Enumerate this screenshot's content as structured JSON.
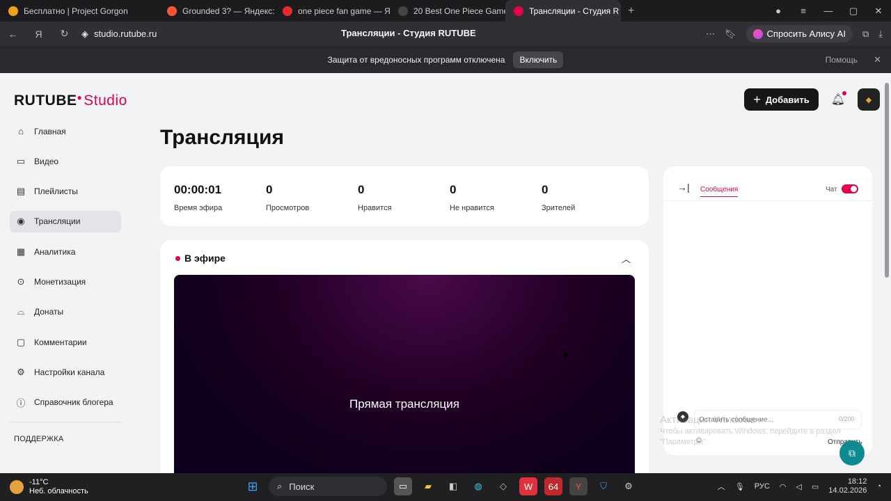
{
  "browser": {
    "tabs": [
      {
        "label": "Бесплатно | Project Gorgon",
        "color": "#f0a020"
      },
      {
        "label": "Grounded 3? — Яндекс: на",
        "color": "#ff5533"
      },
      {
        "label": "one piece fan game — Янд",
        "color": "#e22d2d"
      },
      {
        "label": "20 Best One Piece Games",
        "color": "#444444"
      },
      {
        "label": "Трансляции - Студия R",
        "color": "#e6004c",
        "active": true
      }
    ],
    "new_tab": "+",
    "url": "studio.rutube.ru",
    "page_title": "Трансляции - Студия RUTUBE",
    "alice_label": "Спросить Алису AI"
  },
  "protection": {
    "message": "Защита от вредоносных программ отключена",
    "enable_label": "Включить",
    "help_label": "Помощь"
  },
  "header": {
    "logo_text": "RUTUBE",
    "logo_sub": "Studio",
    "add_label": "Добавить"
  },
  "sidebar": {
    "items": [
      {
        "label": "Главная",
        "icon": "home-icon"
      },
      {
        "label": "Видео",
        "icon": "video-icon"
      },
      {
        "label": "Плейлисты",
        "icon": "playlist-icon"
      },
      {
        "label": "Трансляции",
        "icon": "broadcast-icon",
        "active": true
      },
      {
        "label": "Аналитика",
        "icon": "analytics-icon"
      },
      {
        "label": "Монетизация",
        "icon": "monetization-icon"
      },
      {
        "label": "Донаты",
        "icon": "donations-icon"
      },
      {
        "label": "Комментарии",
        "icon": "comments-icon"
      },
      {
        "label": "Настройки канала",
        "icon": "settings-icon"
      },
      {
        "label": "Справочник блогера",
        "icon": "help-icon"
      }
    ],
    "support_label": "ПОДДЕРЖКА"
  },
  "main": {
    "title": "Трансляция",
    "stats": [
      {
        "value": "00:00:01",
        "label": "Время эфира"
      },
      {
        "value": "0",
        "label": "Просмотров"
      },
      {
        "value": "0",
        "label": "Нравится"
      },
      {
        "value": "0",
        "label": "Не нравится"
      },
      {
        "value": "0",
        "label": "Зрителей"
      }
    ],
    "live_label": "В эфире",
    "player_text": "Прямая трансляция"
  },
  "chat": {
    "tab_label": "Сообщения",
    "toggle_label": "Чат",
    "input_placeholder": "Оставить сообщение...",
    "counter": "0/200",
    "send_label": "Отправить"
  },
  "watermark": {
    "title": "Активация Windows",
    "line1": "Чтобы активировать Windows, перейдите в раздел",
    "line2": "\"Параметры\"."
  },
  "taskbar": {
    "temp": "-11°C",
    "weather": "Неб. облачность",
    "search_label": "Поиск",
    "lang": "РУС",
    "time": "18:12",
    "date": "14.02.2026"
  },
  "colors": {
    "accent": "#e6004c",
    "dark": "#17171a",
    "help_fab": "#0e8a93"
  }
}
